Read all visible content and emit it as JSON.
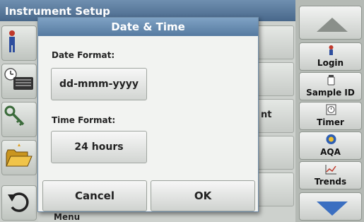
{
  "screen": {
    "title": "Instrument Setup",
    "list_row_text": "nt",
    "bottom_label": "Menu"
  },
  "left_icons": [
    "operator-icon",
    "clock-keyboard-icon",
    "key-icon",
    "folder-icon",
    "back-arrow-icon"
  ],
  "right_panel": {
    "scroll_up_icon": "arrow-up-icon",
    "scroll_down_icon": "arrow-down-icon",
    "buttons": [
      {
        "label": "Login",
        "icon": "person-icon"
      },
      {
        "label": "Sample ID",
        "icon": "sample-bottle-icon"
      },
      {
        "label": "Timer",
        "icon": "timer-icon"
      },
      {
        "label": "AQA",
        "icon": "aqa-icon"
      },
      {
        "label": "Trends",
        "icon": "trends-chart-icon"
      }
    ]
  },
  "dialog": {
    "title": "Date & Time",
    "date_format_label": "Date Format:",
    "date_format_value": "dd-mmm-yyyy",
    "time_format_label": "Time Format:",
    "time_format_value": "24 hours",
    "cancel_label": "Cancel",
    "ok_label": "OK"
  },
  "colors": {
    "title_bar": "#48678a",
    "dialog_title": "#567aa0",
    "scroll_down_arrow": "#3b6fc1"
  }
}
